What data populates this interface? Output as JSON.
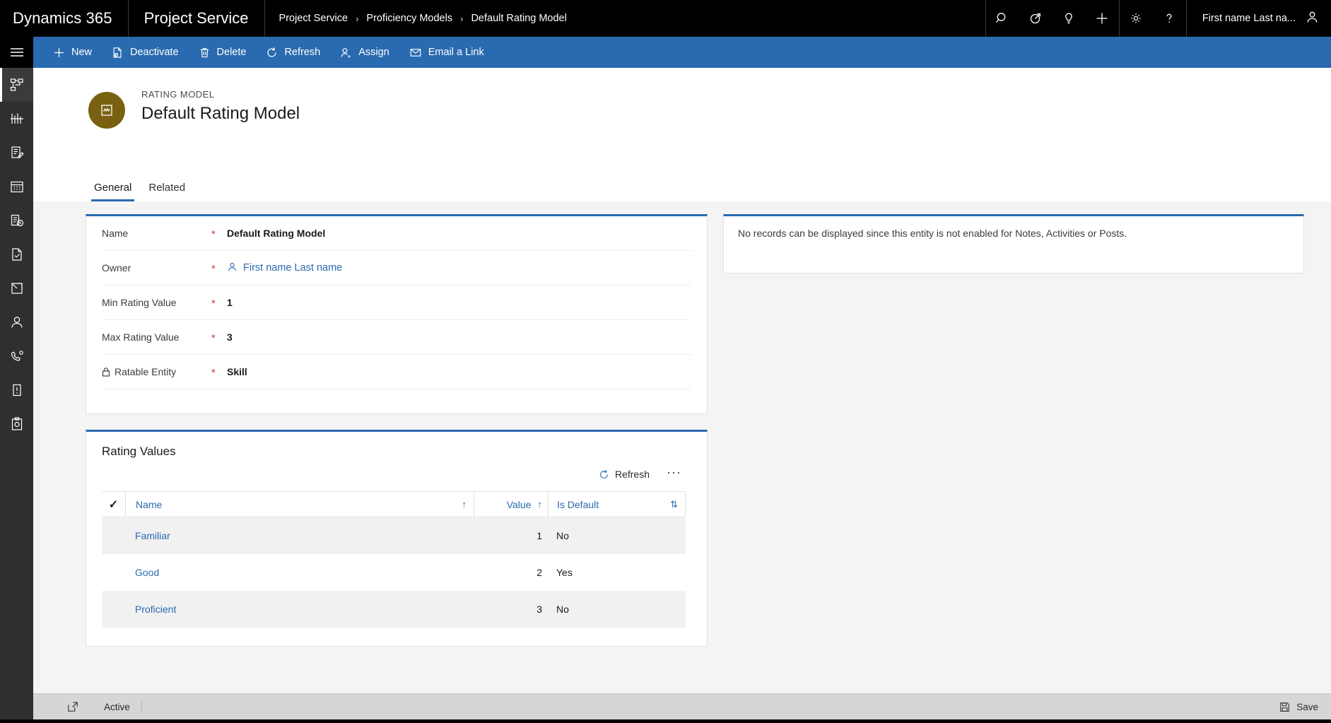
{
  "topnav": {
    "brand": "Dynamics 365",
    "app": "Project Service",
    "breadcrumbs": [
      {
        "label": "Project Service"
      },
      {
        "label": "Proficiency Models"
      },
      {
        "label": "Default Rating Model"
      }
    ],
    "separator": "›",
    "icons": [
      {
        "name": "search-icon"
      },
      {
        "name": "assistant-icon"
      },
      {
        "name": "lightbulb-icon"
      },
      {
        "name": "quick-create-icon"
      }
    ],
    "settings_icons": [
      {
        "name": "gear-icon"
      },
      {
        "name": "help-icon"
      }
    ],
    "user": {
      "label": "First name Last na...",
      "icon": "user-avatar-icon"
    }
  },
  "rail": {
    "hamburger": "site-map-icon",
    "items": [
      {
        "name": "sitemap-icon",
        "selected": true
      },
      {
        "name": "dashboard-icon",
        "selected": false
      },
      {
        "name": "activities-icon",
        "selected": false
      },
      {
        "name": "calendar-icon",
        "selected": false
      },
      {
        "name": "reports-icon",
        "selected": false
      },
      {
        "name": "documents-icon",
        "selected": false
      },
      {
        "name": "archive-icon",
        "selected": false
      },
      {
        "name": "contact-icon",
        "selected": false
      },
      {
        "name": "service-icon",
        "selected": false
      },
      {
        "name": "cases-icon",
        "selected": false
      },
      {
        "name": "resources-icon",
        "selected": false
      }
    ]
  },
  "commandbar": {
    "buttons": [
      {
        "label": "New",
        "icon": "plus-icon"
      },
      {
        "label": "Deactivate",
        "icon": "deactivate-icon"
      },
      {
        "label": "Delete",
        "icon": "trash-icon"
      },
      {
        "label": "Refresh",
        "icon": "refresh-icon"
      },
      {
        "label": "Assign",
        "icon": "assign-user-icon"
      },
      {
        "label": "Email a Link",
        "icon": "email-link-icon"
      }
    ]
  },
  "record_header": {
    "kicker": "RATING MODEL",
    "title": "Default Rating Model",
    "avatar_icon": "rating-model-icon",
    "avatar_color": "#7a6111"
  },
  "tabs": [
    {
      "label": "General",
      "active": true
    },
    {
      "label": "Related",
      "active": false
    }
  ],
  "form": {
    "fields": [
      {
        "label": "Name",
        "required": "*",
        "value": "Default Rating Model",
        "type": "text",
        "locked": false
      },
      {
        "label": "Owner",
        "required": "*",
        "value": "First name Last name",
        "type": "lookup",
        "icon": "user-icon",
        "locked": false
      },
      {
        "label": "Min Rating Value",
        "required": "*",
        "value": "1",
        "type": "text",
        "locked": false
      },
      {
        "label": "Max Rating Value",
        "required": "*",
        "value": "3",
        "type": "text",
        "locked": false
      },
      {
        "label": "Ratable Entity",
        "required": "*",
        "value": "Skill",
        "type": "text",
        "locked": true,
        "lock_icon": "lock-icon"
      }
    ]
  },
  "notes_panel": {
    "message": "No records can be displayed since this entity is not enabled for Notes, Activities or Posts."
  },
  "subgrid": {
    "title": "Rating Values",
    "toolbar": {
      "refresh_label": "Refresh",
      "refresh_icon": "refresh-icon",
      "more_label": "···",
      "more_icon": "ellipsis-icon"
    },
    "columns": [
      {
        "label": "Name",
        "sort": "↑"
      },
      {
        "label": "Value",
        "sort": "↑"
      },
      {
        "label": "Is Default",
        "sort": "⇅"
      }
    ],
    "select_all_icon": "checkmark-icon",
    "rows": [
      {
        "name": "Familiar",
        "value": "1",
        "is_default": "No"
      },
      {
        "name": "Good",
        "value": "2",
        "is_default": "Yes"
      },
      {
        "name": "Proficient",
        "value": "3",
        "is_default": "No"
      }
    ]
  },
  "footer": {
    "popout_icon": "popout-icon",
    "status": "Active",
    "save_label": "Save",
    "save_icon": "save-icon"
  },
  "colors": {
    "topnav_bg": "#000000",
    "commandbar_bg": "#2a6ab0",
    "accent": "#2a6ab0",
    "rail_bg": "#2f2f2f",
    "canvas_bg": "#f4f4f4",
    "required": "#d23f31",
    "link": "#2a6ab0",
    "footer_bg": "#d6d6d6",
    "avatar": "#7a6111"
  }
}
